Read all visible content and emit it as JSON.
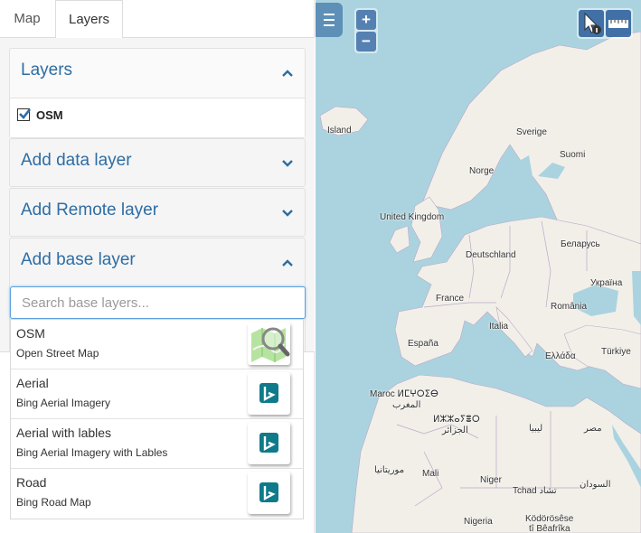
{
  "tabs": [
    {
      "label": "Map"
    },
    {
      "label": "Layers"
    }
  ],
  "sections": {
    "layers": {
      "title": "Layers",
      "items": [
        {
          "label": "OSM",
          "checked": true
        }
      ]
    },
    "add_data": {
      "title": "Add data layer"
    },
    "add_remote": {
      "title": "Add Remote layer"
    },
    "add_base": {
      "title": "Add base layer"
    }
  },
  "search": {
    "placeholder": "Search base layers..."
  },
  "results": [
    {
      "name": "OSM",
      "description": "Open Street Map",
      "icon": "osm-map-icon"
    },
    {
      "name": "Aerial",
      "description": "Bing Aerial Imagery",
      "icon": "bing-logo-icon"
    },
    {
      "name": "Aerial with lables",
      "description": "Bing Aerial Imagery with Lables",
      "icon": "bing-logo-icon"
    },
    {
      "name": "Road",
      "description": "Bing Road Map",
      "icon": "bing-logo-icon"
    }
  ],
  "map": {
    "zoom_in": "+",
    "zoom_out": "−",
    "labels": {
      "island": "Island",
      "sverige": "Sverige",
      "suomi": "Suomi",
      "norge": "Norge",
      "uk": "United Kingdom",
      "belarus": "Беларусь",
      "deutschland": "Deutschland",
      "ukraina": "Україна",
      "france": "France",
      "romania": "România",
      "italia": "Italia",
      "espana": "España",
      "turkiye": "Türkiye",
      "ellada": "Ελλάδα",
      "maroc": "Maroc ⵍⵎⵖⵔⵉⴱ",
      "maghrib": "المغرب",
      "djazair1": "ⵍⵣⵣⴰⵢⴻⵔ",
      "djazair2": "الجزائر",
      "libya": "ليبيا",
      "misr": "مصر",
      "mauritania": "موريتانيا",
      "mali": "Mali",
      "niger": "Niger",
      "tchad": "Tchad تشاد",
      "sudan": "السودان",
      "nigeria": "Nigeria",
      "kodorosese": "Ködörösêse",
      "tii": "tî Bêafrîka"
    },
    "colors": {
      "sea": "#aad3df",
      "land": "#f2efe9",
      "border": "#b9a8c7",
      "accent": "#003c88"
    }
  }
}
